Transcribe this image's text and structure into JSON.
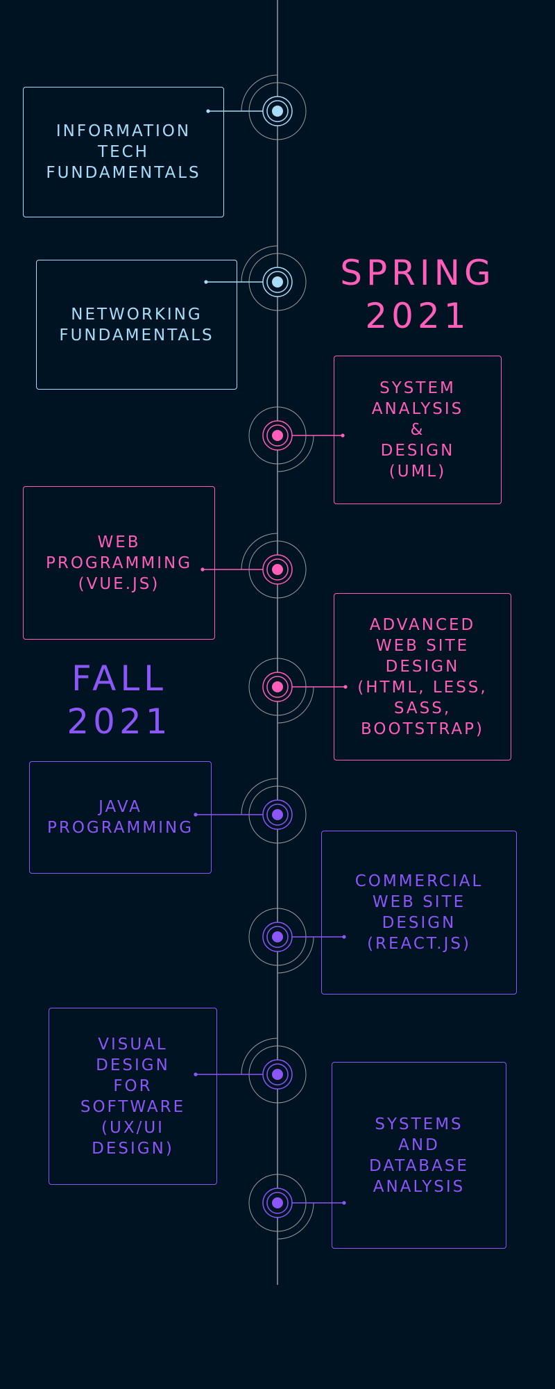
{
  "colors": {
    "background": "#001322",
    "blue": "#a8dcfa",
    "pink": "#ff5eb9",
    "purple": "#8b57f6",
    "line": "#9a9a9a"
  },
  "seasons": [
    {
      "name": "Spring",
      "lines": [
        "SPRING",
        "2021"
      ],
      "color": "pink"
    },
    {
      "name": "Fall",
      "lines": [
        "FALL",
        "2021"
      ],
      "color": "purple"
    }
  ],
  "courses": [
    {
      "lines": [
        "INFORMATION",
        "TECH",
        "FUNDAMENTALS"
      ],
      "color": "blue",
      "side": "left"
    },
    {
      "lines": [
        "NETWORKING",
        "FUNDAMENTALS"
      ],
      "color": "blue",
      "side": "left"
    },
    {
      "lines": [
        "SYSTEM",
        "ANALYSIS",
        "&",
        "DESIGN",
        "(UML)"
      ],
      "color": "pink",
      "side": "right"
    },
    {
      "lines": [
        "WEB",
        "PROGRAMMING",
        "(VUE.JS)"
      ],
      "color": "pink",
      "side": "left"
    },
    {
      "lines": [
        "ADVANCED",
        "WEB SITE",
        "DESIGN",
        "(HTML, LESS,",
        "SASS,",
        "BOOTSTRAP)"
      ],
      "color": "pink",
      "side": "right"
    },
    {
      "lines": [
        "JAVA",
        "PROGRAMMING"
      ],
      "color": "purple",
      "side": "left"
    },
    {
      "lines": [
        "COMMERCIAL",
        "WEB SITE",
        "DESIGN",
        "(REACT.JS)"
      ],
      "color": "purple",
      "side": "right"
    },
    {
      "lines": [
        "VISUAL",
        "DESIGN",
        "FOR",
        "SOFTWARE",
        "(UX/UI",
        "DESIGN)"
      ],
      "color": "purple",
      "side": "left"
    },
    {
      "lines": [
        "SYSTEMS",
        "AND",
        "DATABASE",
        "ANALYSIS"
      ],
      "color": "purple",
      "side": "right"
    }
  ]
}
